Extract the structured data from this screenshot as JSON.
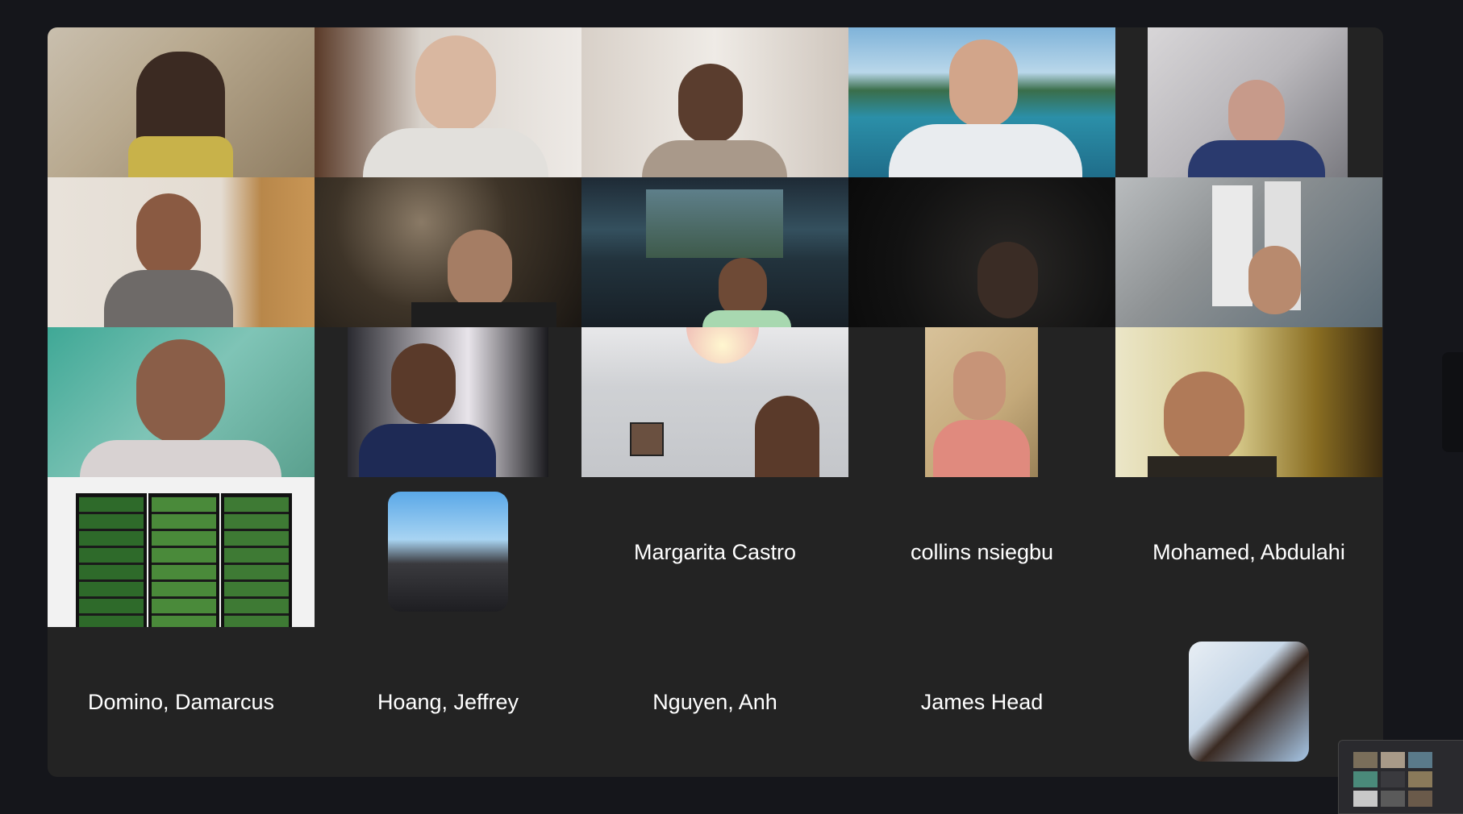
{
  "meeting": {
    "view": "gallery",
    "participants": [
      {
        "row": 0,
        "col": 0,
        "type": "video"
      },
      {
        "row": 0,
        "col": 1,
        "type": "video"
      },
      {
        "row": 0,
        "col": 2,
        "type": "video"
      },
      {
        "row": 0,
        "col": 3,
        "type": "video"
      },
      {
        "row": 0,
        "col": 4,
        "type": "video"
      },
      {
        "row": 1,
        "col": 0,
        "type": "video"
      },
      {
        "row": 1,
        "col": 1,
        "type": "video"
      },
      {
        "row": 1,
        "col": 2,
        "type": "video"
      },
      {
        "row": 1,
        "col": 3,
        "type": "video"
      },
      {
        "row": 1,
        "col": 4,
        "type": "video"
      },
      {
        "row": 2,
        "col": 0,
        "type": "video"
      },
      {
        "row": 2,
        "col": 1,
        "type": "video"
      },
      {
        "row": 2,
        "col": 2,
        "type": "video"
      },
      {
        "row": 2,
        "col": 3,
        "type": "video"
      },
      {
        "row": 2,
        "col": 4,
        "type": "video"
      },
      {
        "row": 3,
        "col": 0,
        "type": "video"
      },
      {
        "row": 3,
        "col": 1,
        "type": "avatar"
      },
      {
        "row": 3,
        "col": 2,
        "type": "name",
        "name": "Margarita Castro"
      },
      {
        "row": 3,
        "col": 3,
        "type": "name",
        "name": "collins nsiegbu"
      },
      {
        "row": 3,
        "col": 4,
        "type": "name",
        "name": "Mohamed, Abdulahi"
      },
      {
        "row": 4,
        "col": 0,
        "type": "name",
        "name": "Domino, Damarcus"
      },
      {
        "row": 4,
        "col": 1,
        "type": "name",
        "name": "Hoang, Jeffrey"
      },
      {
        "row": 4,
        "col": 2,
        "type": "name",
        "name": "Nguyen, Anh"
      },
      {
        "row": 4,
        "col": 3,
        "type": "name",
        "name": "James Head"
      },
      {
        "row": 4,
        "col": 4,
        "type": "avatar"
      }
    ],
    "names": {
      "margarita": "Margarita Castro",
      "collins": "collins nsiegbu",
      "mohamed": "Mohamed, Abdulahi",
      "domino": "Domino, Damarcus",
      "hoang": "Hoang, Jeffrey",
      "nguyen": "Nguyen, Anh",
      "james": "James Head"
    }
  },
  "colors": {
    "background": "#15161b",
    "gallery_panel": "#232323",
    "name_text": "#ffffff"
  }
}
